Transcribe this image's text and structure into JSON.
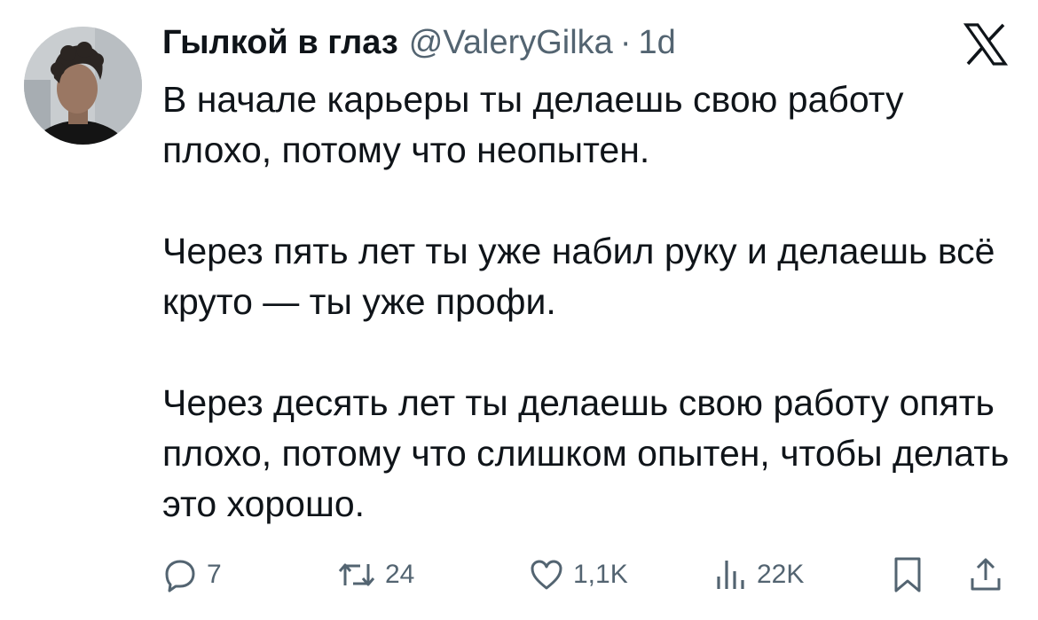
{
  "tweet": {
    "author": {
      "display_name": "Гылкой в глаз",
      "handle": "@ValeryGilka",
      "separator": "·",
      "time": "1d"
    },
    "paragraphs": [
      "В начале карьеры ты делаешь свою работу плохо, потому что неопытен.",
      "Через пять лет ты уже набил руку и делаешь всё круто — ты уже профи.",
      "Через десять лет ты делаешь свою работу опять плохо, потому что слишком опытен, чтобы делать это хорошо."
    ],
    "actions": {
      "replies": "7",
      "retweets": "24",
      "likes": "1,1K",
      "views": "22K"
    }
  },
  "icons": {
    "brand": "x-logo-icon",
    "reply": "reply-icon",
    "retweet": "retweet-icon",
    "like": "heart-icon",
    "views": "views-icon",
    "bookmark": "bookmark-icon",
    "share": "share-icon"
  },
  "colors": {
    "text": "#0f1419",
    "secondary": "#536471",
    "background": "#ffffff"
  }
}
